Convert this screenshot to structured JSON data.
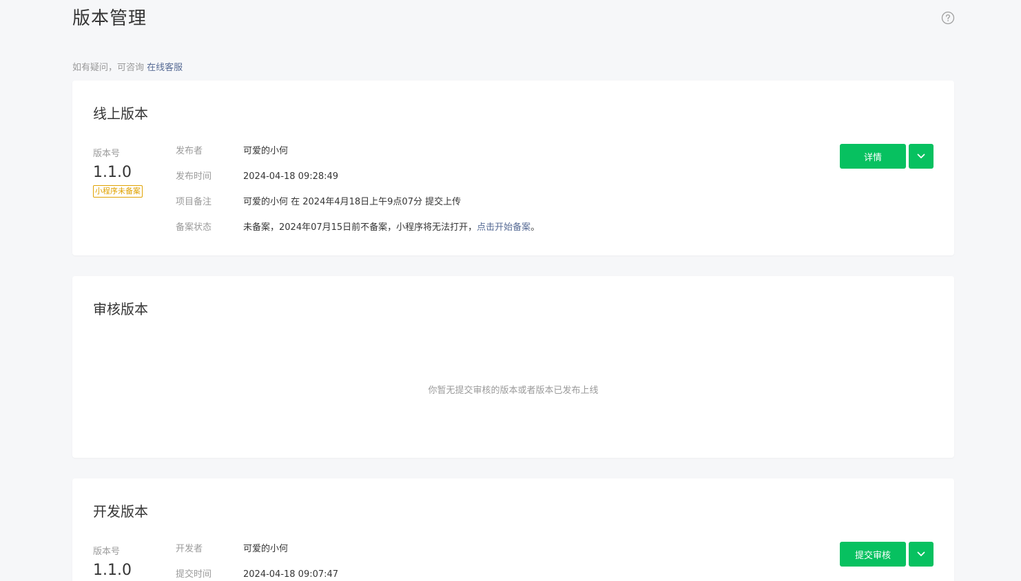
{
  "page": {
    "title": "版本管理",
    "notice_prefix": "如有疑问，可咨询 ",
    "notice_link": "在线客服"
  },
  "online": {
    "title": "线上版本",
    "version_label": "版本号",
    "version": "1.1.0",
    "tag": "小程序未备案",
    "rows": [
      {
        "label": "发布者",
        "value": "可爱的小何"
      },
      {
        "label": "发布时间",
        "value": "2024-04-18 09:28:49"
      },
      {
        "label": "项目备注",
        "value": "可爱的小何 在 2024年4月18日上午9点07分 提交上传"
      },
      {
        "label": "备案状态",
        "value": "未备案，2024年07月15日前不备案，小程序将无法打开，",
        "link": "点击开始备案",
        "suffix": "。"
      }
    ],
    "button_label": "详情"
  },
  "review": {
    "title": "审核版本",
    "empty_text": "你暂无提交审核的版本或者版本已发布上线"
  },
  "dev": {
    "title": "开发版本",
    "version_label": "版本号",
    "version": "1.1.0",
    "rows": [
      {
        "label": "开发者",
        "value": "可爱的小何"
      },
      {
        "label": "提交时间",
        "value": "2024-04-18 09:07:47"
      }
    ],
    "button_label": "提交审核"
  },
  "colors": {
    "accent": "#07c160",
    "link": "#576b95",
    "tag": "#e0a200",
    "background": "#f6f7f9"
  },
  "icons": {
    "help": "question-circle-icon",
    "dropdown": "chevron-down-icon"
  }
}
